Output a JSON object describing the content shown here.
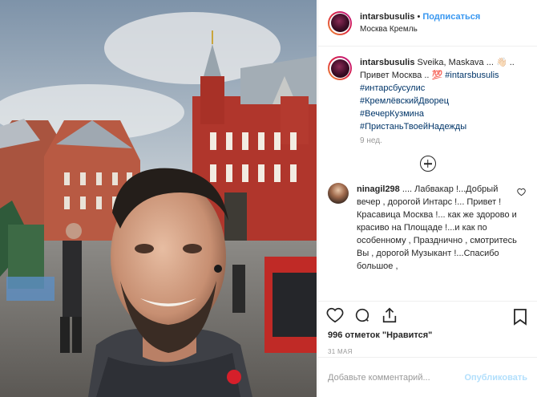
{
  "post": {
    "username": "intarsbusulis",
    "follow_label": "Подписаться",
    "location": "Москва Кремль",
    "caption_username": "intarsbusulis",
    "caption_line1": "Sveika, Maskava ...",
    "caption_line2_text": "Привет Москва ..",
    "caption_emoji": "💯",
    "hashtags": [
      "#intarsbusulis",
      "#интарсбусулис",
      "#КремлёвскийДворец",
      "#ВечерКузмина",
      "#ПристаньТвоейНадежды"
    ],
    "time_ago": "9 нед.",
    "likes": "996 отметок \"Нравится\"",
    "date": "31 МАЯ"
  },
  "comment": {
    "username": "ninagil298",
    "text": ".... Лабвакар !...Добрый вечер , дорогой Интарс !... Привет ! Красавица Москва !... как же здорово и красиво на Площаде !...и как по особенному , Празднично , смотритесь Вы , дорогой Музыкант !...Спасибо большое ,"
  },
  "footer": {
    "comment_placeholder": "Добавьте комментарий...",
    "publish_label": "Опубликовать"
  },
  "icons": {
    "heart": "heart-icon",
    "comment": "comment-icon",
    "share": "share-icon",
    "bookmark": "bookmark-icon",
    "plus": "plus-circle-icon"
  },
  "colors": {
    "link_blue": "#3897f0",
    "hashtag": "#003569",
    "muted": "#999999",
    "disabled_blue": "#b2dffc"
  }
}
